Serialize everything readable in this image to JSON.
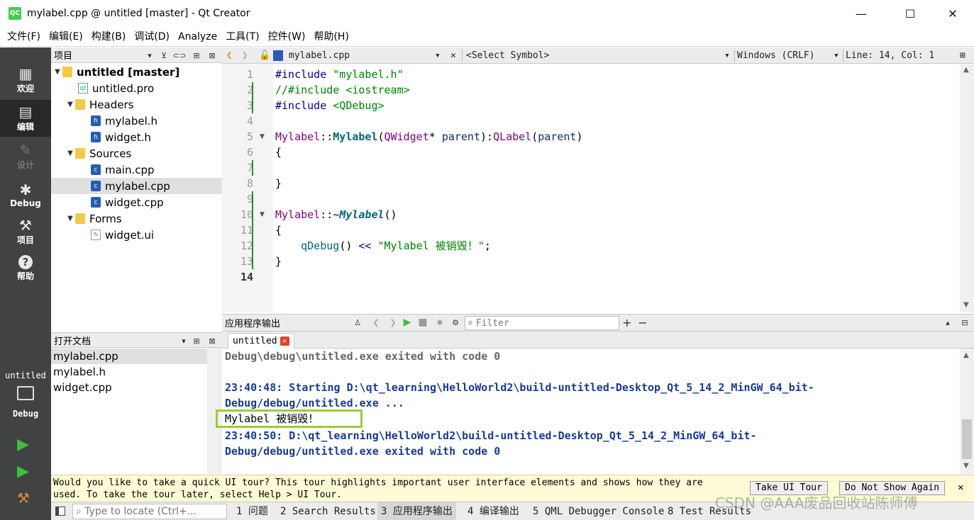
{
  "window": {
    "title": "mylabel.cpp @ untitled [master] - Qt Creator",
    "app_icon": "QC",
    "minimize": "—",
    "maximize": "☐",
    "close": "✕"
  },
  "menu": [
    "文件(F)",
    "编辑(E)",
    "构建(B)",
    "调试(D)",
    "Analyze",
    "工具(T)",
    "控件(W)",
    "帮助(H)"
  ],
  "modes": [
    {
      "name": "welcome",
      "label": "欢迎",
      "icon": "grid-icon",
      "glyph": "▦"
    },
    {
      "name": "edit",
      "label": "编辑",
      "icon": "edit-doc-icon",
      "glyph": "▤"
    },
    {
      "name": "design",
      "label": "设计",
      "icon": "pencil-icon",
      "glyph": "✎"
    },
    {
      "name": "debug",
      "label": "Debug",
      "icon": "bug-icon",
      "glyph": "✱"
    },
    {
      "name": "projects",
      "label": "项目",
      "icon": "wrench-icon",
      "glyph": "⚒"
    },
    {
      "name": "help",
      "label": "帮助",
      "icon": "help-icon",
      "glyph": "?"
    }
  ],
  "kit": {
    "project": "untitled",
    "config": "Debug",
    "run": "▶",
    "debug_run": "▶",
    "build": "⚒"
  },
  "project_pane": {
    "title": "项目",
    "tree": [
      {
        "label": "untitled [master]",
        "type": "project",
        "indent": 0,
        "arrow": "▼",
        "bold": true
      },
      {
        "label": "untitled.pro",
        "type": "pro",
        "indent": 1,
        "arrow": ""
      },
      {
        "label": "Headers",
        "type": "folder",
        "indent": 1,
        "arrow": "▼"
      },
      {
        "label": "mylabel.h",
        "type": "cpp",
        "indent": 2,
        "arrow": ""
      },
      {
        "label": "widget.h",
        "type": "cpp",
        "indent": 2,
        "arrow": ""
      },
      {
        "label": "Sources",
        "type": "folder",
        "indent": 1,
        "arrow": "▼"
      },
      {
        "label": "main.cpp",
        "type": "cpp",
        "indent": 2,
        "arrow": ""
      },
      {
        "label": "mylabel.cpp",
        "type": "cpp",
        "indent": 2,
        "arrow": "",
        "selected": true
      },
      {
        "label": "widget.cpp",
        "type": "cpp",
        "indent": 2,
        "arrow": ""
      },
      {
        "label": "Forms",
        "type": "folder",
        "indent": 1,
        "arrow": "▼"
      },
      {
        "label": "widget.ui",
        "type": "ui",
        "indent": 2,
        "arrow": ""
      }
    ]
  },
  "open_docs": {
    "title": "打开文档",
    "items": [
      {
        "label": "mylabel.cpp",
        "selected": true
      },
      {
        "label": "mylabel.h"
      },
      {
        "label": "widget.cpp"
      }
    ]
  },
  "editor": {
    "file": "mylabel.cpp",
    "symbol": "<Select Symbol>",
    "line_ending": "Windows (CRLF)",
    "position": "Line: 14, Col: 1",
    "line_numbers": [
      "1",
      "2",
      "3",
      "4",
      "5",
      "6",
      "7",
      "8",
      "9",
      "10",
      "11",
      "12",
      "13",
      "14"
    ],
    "current_line": "14",
    "code": {
      "l1a": "#include ",
      "l1b": "\"mylabel.h\"",
      "l2": "//#include <iostream>",
      "l3a": "#include ",
      "l3b": "<QDebug>",
      "l5a": "Mylabel",
      "l5b": "::",
      "l5c": "Mylabel",
      "l5d": "(",
      "l5e": "QWidget",
      "l5f": "* ",
      "l5g": "parent",
      "l5h": "):",
      "l5i": "QLabel",
      "l5j": "(",
      "l5k": "parent",
      "l5l": ")",
      "l6": "{",
      "l8": "}",
      "l10a": "Mylabel",
      "l10b": "::~",
      "l10c": "Mylabel",
      "l10d": "()",
      "l11": "{",
      "l12a": "    qDebug",
      "l12b": "() ",
      "l12c": "<<",
      "l12d": " \"Mylabel 被销毁！\"",
      "l12e": ";",
      "l13": "}"
    }
  },
  "output": {
    "title": "应用程序输出",
    "filter_placeholder": "Filter",
    "tab": "untitled",
    "lines": [
      "Debug\\debug\\untitled.exe exited with code 0",
      "",
      "23:40:48: Starting D:\\qt_learning\\HelloWorld2\\build-untitled-Desktop_Qt_5_14_2_MinGW_64_bit-",
      "Debug/debug/untitled.exe ...",
      "Mylabel 被销毁！",
      "23:40:50: D:\\qt_learning\\HelloWorld2\\build-untitled-Desktop_Qt_5_14_2_MinGW_64_bit-",
      "Debug/debug/untitled.exe exited with code 0"
    ]
  },
  "tour": {
    "text": "Would you like to take a quick UI tour? This tour highlights important user interface elements and shows how they are used. To take the tour later, select Help > UI Tour.",
    "take_button": "Take UI Tour",
    "dismiss_button": "Do Not Show Again",
    "close": "✕"
  },
  "statusbar": {
    "locate_placeholder": "Type to locate (Ctrl+...",
    "tabs": [
      "1 问题",
      "2 Search Results",
      "3 应用程序输出",
      "4 编译输出",
      "5 QML Debugger Console",
      "8 Test Results"
    ]
  },
  "watermark": "CSDN @AAA废品回收站陈师傅"
}
